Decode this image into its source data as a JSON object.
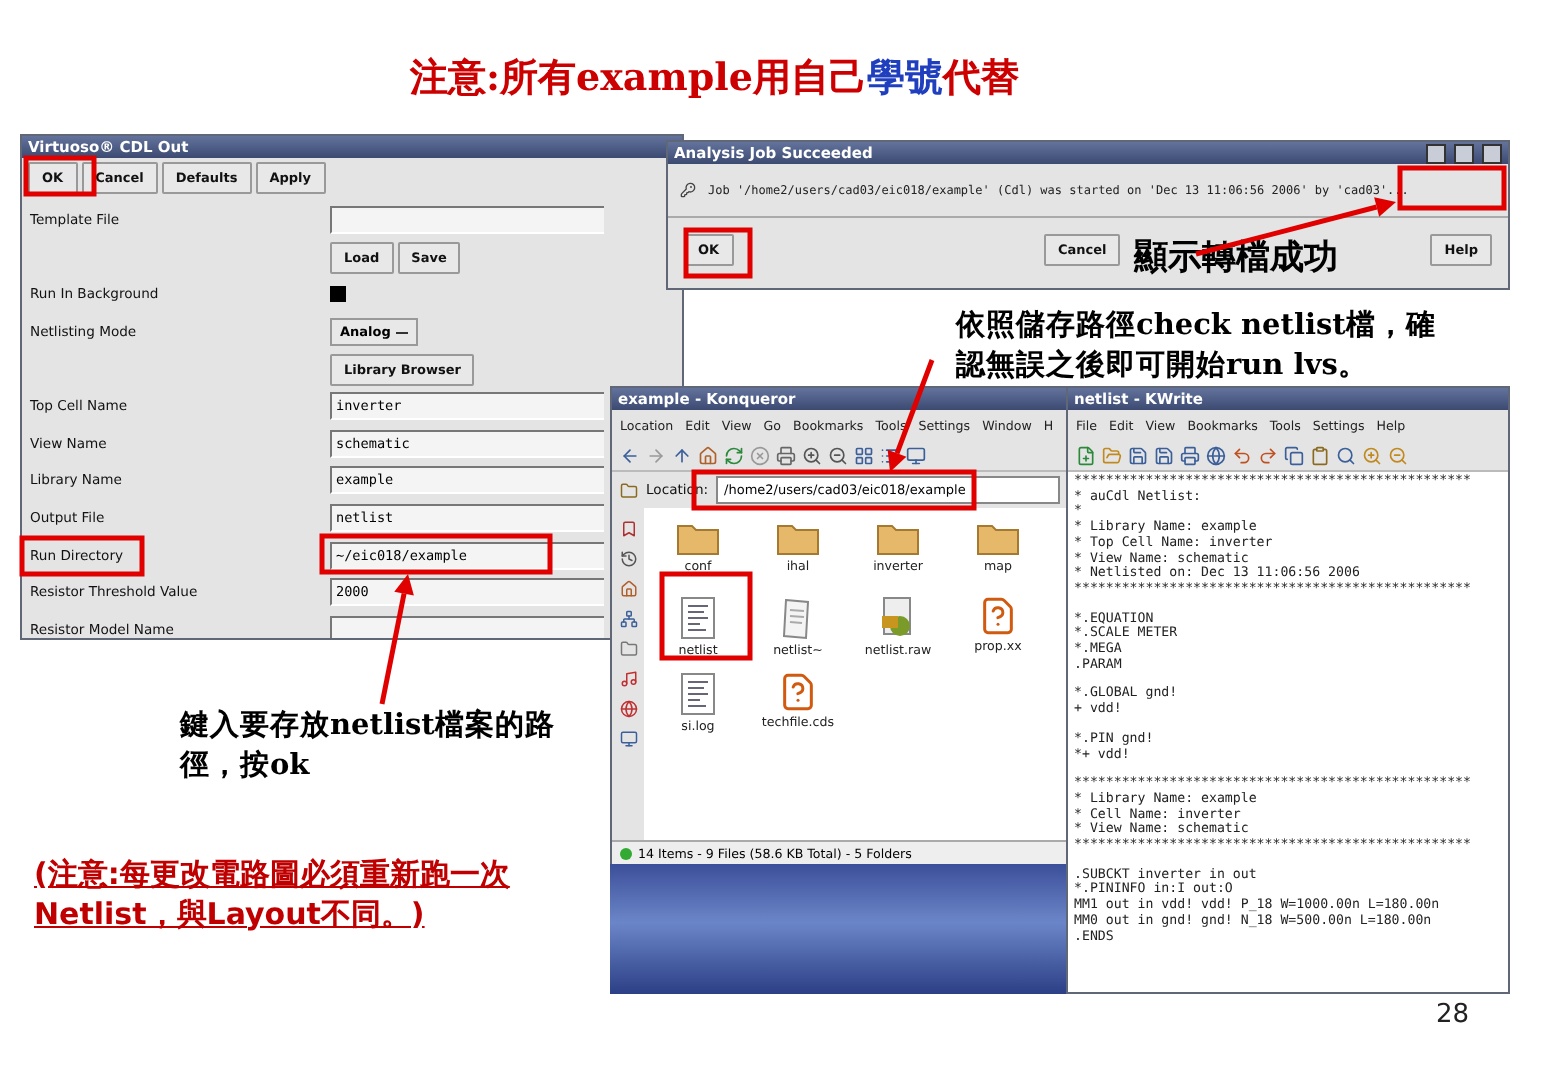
{
  "title": [
    {
      "text": "注意:所有example用自己",
      "color": "#cc0000"
    },
    {
      "text": "學號",
      "color": "#1f3fbf"
    },
    {
      "text": "代替",
      "color": "#cc0000"
    }
  ],
  "cdl_window": {
    "title": "Virtuoso® CDL Out",
    "buttons": [
      "OK",
      "Cancel",
      "Defaults",
      "Apply"
    ],
    "rows": [
      {
        "kind": "field",
        "label": "Template File"
      },
      {
        "kind": "buttons",
        "buttons": [
          "Load",
          "Save"
        ]
      },
      {
        "kind": "checkbox",
        "label": "Run In Background",
        "checked": true
      },
      {
        "kind": "menu",
        "label": "Netlisting Mode",
        "value": "Analog"
      },
      {
        "kind": "buttons",
        "buttons": [
          "Library Browser"
        ]
      },
      {
        "kind": "field",
        "label": "Top Cell Name",
        "value": "inverter"
      },
      {
        "kind": "field",
        "label": "View Name",
        "value": "schematic"
      },
      {
        "kind": "field",
        "label": "Library Name",
        "value": "example"
      },
      {
        "kind": "field",
        "label": "Output File",
        "value": "netlist"
      },
      {
        "kind": "field",
        "label": "Run Directory",
        "value": "~/eic018/example"
      },
      {
        "kind": "field",
        "label": "Resistor Threshold Value",
        "value": "2000"
      },
      {
        "kind": "field",
        "label": "Resistor Model Name"
      }
    ]
  },
  "analysis_window": {
    "title": "Analysis Job Succeeded",
    "message": "Job '/home2/users/cad03/eic018/example' (Cdl) was started on 'Dec 13 11:06:56 2006' by 'cad03'...",
    "buttons": [
      "OK",
      "Cancel",
      "Help"
    ]
  },
  "konqueror_window": {
    "title": "example - Konqueror",
    "menu": [
      "Location",
      "Edit",
      "View",
      "Go",
      "Bookmarks",
      "Tools",
      "Settings",
      "Window",
      "H"
    ],
    "location_label": "Location:",
    "location": "/home2/users/cad03/eic018/example",
    "files": [
      {
        "name": "conf",
        "kind": "folder"
      },
      {
        "name": "ihal",
        "kind": "folder"
      },
      {
        "name": "inverter",
        "kind": "folder"
      },
      {
        "name": "map",
        "kind": "folder"
      },
      {
        "name": "netlist",
        "kind": "text"
      },
      {
        "name": "netlist~",
        "kind": "document"
      },
      {
        "name": "netlist.raw",
        "kind": "script"
      },
      {
        "name": "prop.xx",
        "kind": "unknown"
      },
      {
        "name": "si.log",
        "kind": "text"
      },
      {
        "name": "techfile.cds",
        "kind": "unknown"
      }
    ],
    "status": "14 Items - 9 Files (58.6 KB Total) - 5 Folders"
  },
  "kwrite_window": {
    "title": "netlist - KWrite",
    "menu": [
      "File",
      "Edit",
      "View",
      "Bookmarks",
      "Tools",
      "Settings",
      "Help"
    ],
    "blocks": [
      [
        "**************************************************",
        "* auCdl Netlist:",
        "*",
        "* Library Name: example",
        "* Top Cell Name: inverter",
        "* View Name: schematic",
        "* Netlisted on: Dec 13 11:06:56 2006",
        "**************************************************"
      ],
      [
        "*.EQUATION",
        "*.SCALE METER",
        "*.MEGA",
        ".PARAM"
      ],
      [
        "*.GLOBAL gnd!",
        "+ vdd!"
      ],
      [
        "*.PIN gnd!",
        "*+ vdd!"
      ],
      [
        "**************************************************",
        "* Library Name: example",
        "* Cell Name: inverter",
        "* View Name: schematic",
        "**************************************************"
      ],
      [
        ".SUBCKT inverter in out",
        "*.PININFO in:I out:O",
        "MM1 out in vdd! vdd! P_18 W=1000.00n L=180.00n",
        "MM0 out in gnd! gnd! N_18 W=500.00n L=180.00n",
        ".ENDS"
      ]
    ]
  },
  "annotations": {
    "success": "顯示轉檔成功",
    "check": "依照儲存路徑check netlist檔，確認無誤之後即可開始run lvs。",
    "enter_path": "鍵入要存放netlist檔案的路徑，按ok",
    "note": "(注意:每更改電路圖必須重新跑一次\nNetlist，與Layout不同。)"
  },
  "page_number": "28"
}
